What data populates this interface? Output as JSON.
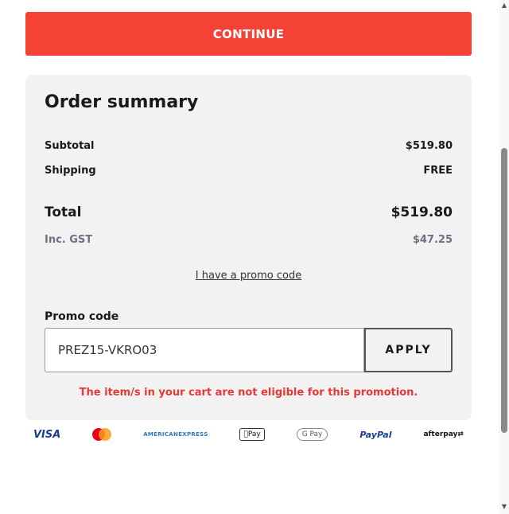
{
  "continue_button": {
    "label": "CONTINUE",
    "color": "#f44336"
  },
  "summary": {
    "title": "Order summary",
    "subtotal": {
      "label": "Subtotal",
      "value": "$519.80"
    },
    "shipping": {
      "label": "Shipping",
      "value": "FREE"
    },
    "total": {
      "label": "Total",
      "value": "$519.80"
    },
    "gst": {
      "label": "Inc. GST",
      "value": "$47.25"
    },
    "promo_link": "I have a promo code",
    "promo": {
      "label": "Promo code",
      "value": "PREZ15-VKRO03",
      "apply_label": "APPLY",
      "error": "The item/s in your cart are not eligible for this promotion.",
      "error_color": "#e53935"
    }
  },
  "payments": {
    "visa": "VISA",
    "amex_line1": "AMERICAN",
    "amex_line2": "EXPRESS",
    "applepay": "Pay",
    "gpay": "G Pay",
    "paypal": "PayPal",
    "afterpay": "afterpay⇄"
  }
}
